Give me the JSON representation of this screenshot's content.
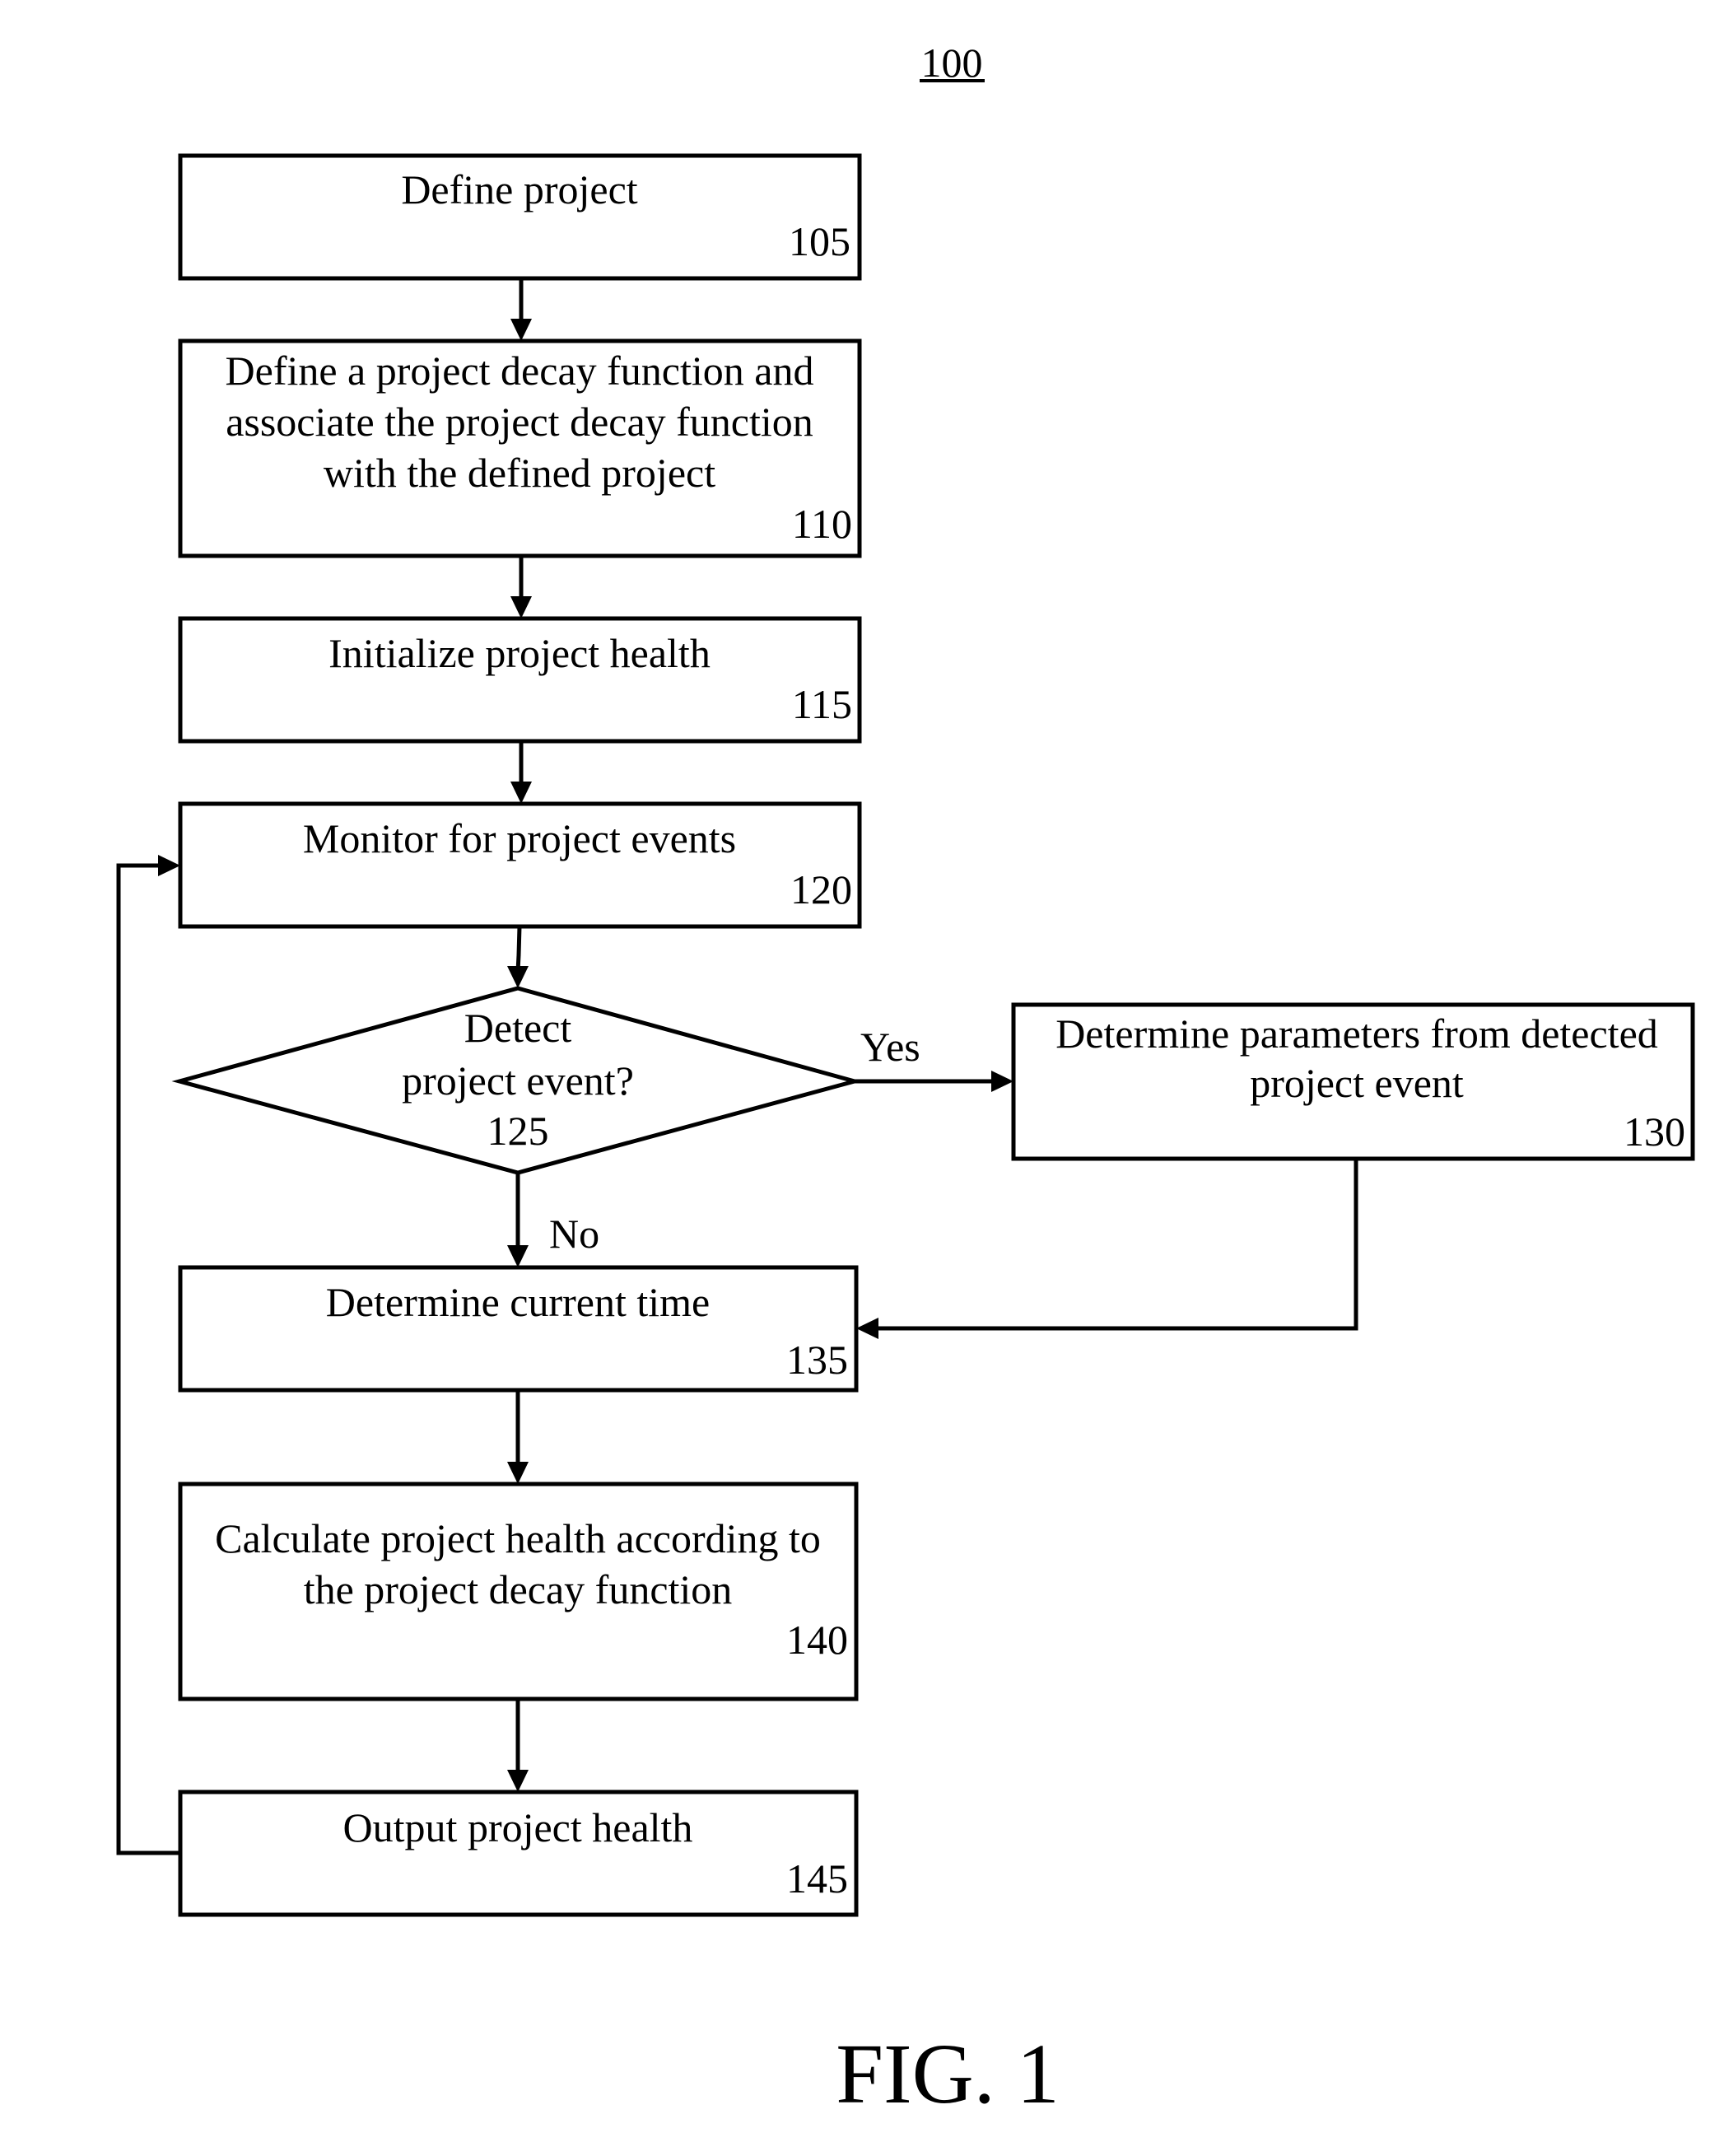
{
  "figure": {
    "reference_number": "100",
    "caption": "FIG. 1"
  },
  "steps": [
    {
      "id": "105",
      "type": "process",
      "lines": [
        "Define project"
      ],
      "label": "105"
    },
    {
      "id": "110",
      "type": "process",
      "lines": [
        "Define a project decay function and",
        "associate the project decay function",
        "with the defined project"
      ],
      "label": "110"
    },
    {
      "id": "115",
      "type": "process",
      "lines": [
        "Initialize project health"
      ],
      "label": "115"
    },
    {
      "id": "120",
      "type": "process",
      "lines": [
        "Monitor for project events"
      ],
      "label": "120"
    },
    {
      "id": "125",
      "type": "decision",
      "lines": [
        "Detect",
        "project event?"
      ],
      "label": "125"
    },
    {
      "id": "130",
      "type": "process",
      "lines": [
        "Determine parameters from detected",
        "project event"
      ],
      "label": "130"
    },
    {
      "id": "135",
      "type": "process",
      "lines": [
        "Determine current time"
      ],
      "label": "135"
    },
    {
      "id": "140",
      "type": "process",
      "lines": [
        "Calculate project health according to",
        "the project decay function"
      ],
      "label": "140"
    },
    {
      "id": "145",
      "type": "process",
      "lines": [
        "Output project health"
      ],
      "label": "145"
    }
  ],
  "edges": [
    {
      "from": "105",
      "to": "110",
      "label": ""
    },
    {
      "from": "110",
      "to": "115",
      "label": ""
    },
    {
      "from": "115",
      "to": "120",
      "label": ""
    },
    {
      "from": "120",
      "to": "125",
      "label": ""
    },
    {
      "from": "125",
      "to": "130",
      "label": "Yes"
    },
    {
      "from": "125",
      "to": "135",
      "label": "No"
    },
    {
      "from": "130",
      "to": "135",
      "label": ""
    },
    {
      "from": "135",
      "to": "140",
      "label": ""
    },
    {
      "from": "140",
      "to": "145",
      "label": ""
    },
    {
      "from": "145",
      "to": "120",
      "label": ""
    }
  ],
  "edge_labels": {
    "yes": "Yes",
    "no": "No"
  }
}
